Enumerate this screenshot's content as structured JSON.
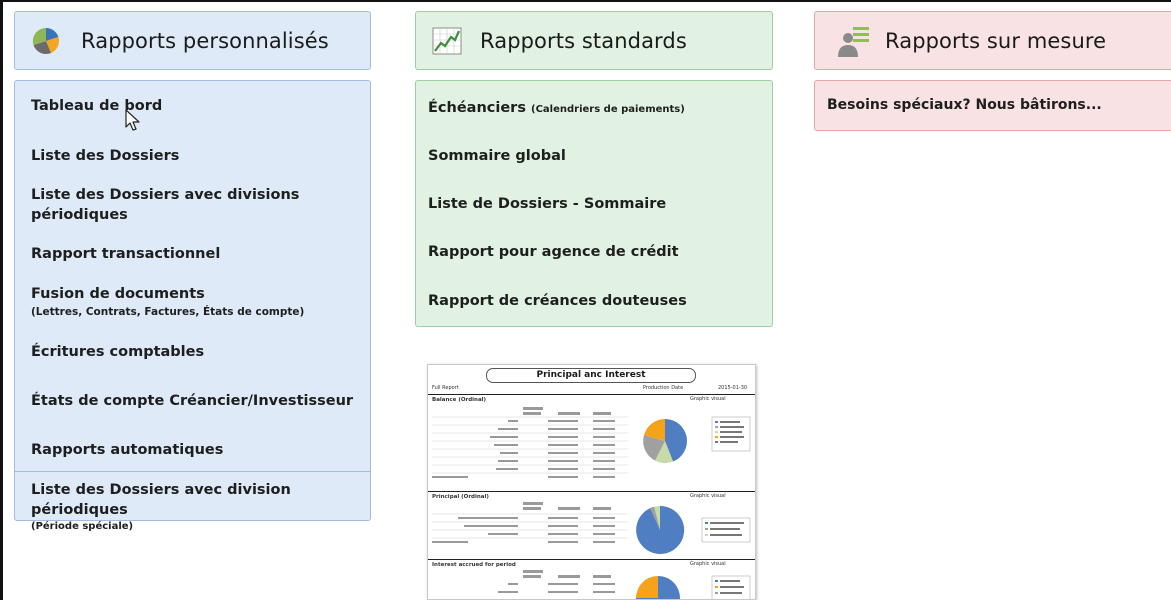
{
  "columns": {
    "custom": {
      "title": "Rapports personnalisés",
      "icon": "pie-chart-icon",
      "items": [
        {
          "label": "Tableau de bord"
        },
        {
          "label": "Liste des Dossiers"
        },
        {
          "label": "Liste des Dossiers avec divisions",
          "label2": "périodiques"
        },
        {
          "label": "Rapport transactionnel"
        },
        {
          "label": "Fusion de documents",
          "sub": "(Lettres, Contrats, Factures, États de compte)"
        },
        {
          "label": "Écritures comptables"
        },
        {
          "label": "États de compte Créancier/Investisseur"
        },
        {
          "label": "Rapports automatiques"
        },
        {
          "label": "Liste des Dossiers avec division périodiques",
          "sub": "(Période spéciale)"
        }
      ]
    },
    "standard": {
      "title": "Rapports standards",
      "icon": "line-chart-icon",
      "items": [
        {
          "label": "Échéanciers",
          "sub": "(Calendriers de paiements)"
        },
        {
          "label": "Sommaire global"
        },
        {
          "label": "Liste de Dossiers - Sommaire"
        },
        {
          "label": "Rapport pour agence de crédit"
        },
        {
          "label": "Rapport de créances douteuses"
        }
      ]
    },
    "bespoke": {
      "title": "Rapports sur mesure",
      "icon": "person-list-icon",
      "items": [
        {
          "label": "Besoins spéciaux? Nous bâtirons..."
        }
      ]
    }
  },
  "preview": {
    "title": "Principal anc Interest",
    "report_label": "Full Report",
    "production_label": "Production Date",
    "production_date": "2015-01-30",
    "sections": [
      "Balance (Ordinal)",
      "Principal (Ordinal)",
      "Interest accrued for period"
    ],
    "graph_label": "Graphic visual"
  },
  "colors": {
    "blue_bg": "#dfeaf8",
    "green_bg": "#e1f2e2",
    "red_bg": "#f8e2e3",
    "pie_blue": "#4f7fc2",
    "pie_orange": "#f5a31a",
    "pie_gray": "#a0a0a0",
    "pie_green": "#c7dba8"
  }
}
